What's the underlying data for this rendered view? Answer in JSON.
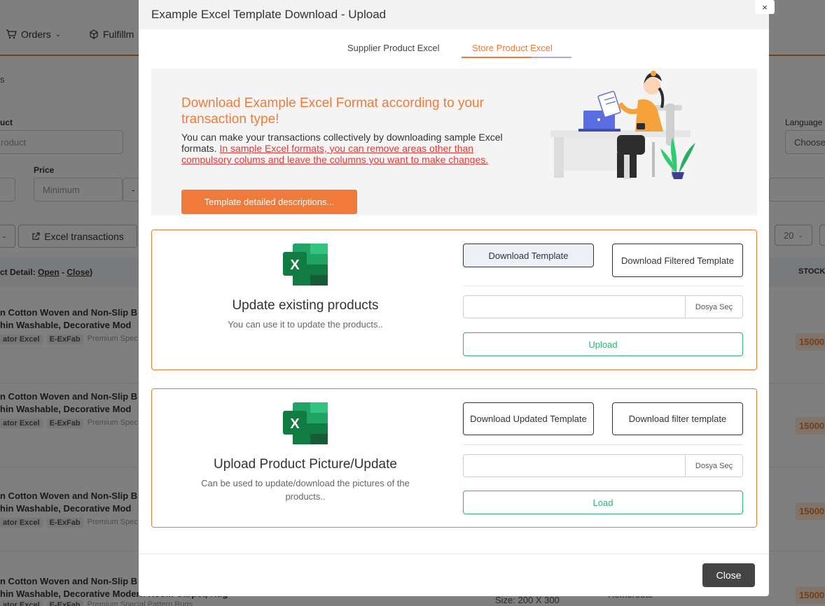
{
  "background": {
    "nav": {
      "orders": "Orders",
      "fulfillment": "Fulfillm"
    },
    "breadcrumb": "s",
    "filters": {
      "product_label": "uct",
      "product_placeholder": "roduct",
      "price_label": "Price",
      "price_min": "Minimum",
      "price_sep": "-",
      "language_label": "Language",
      "language_value": "Choose"
    },
    "excel_button": "Excel transactions",
    "page_size": "20",
    "table": {
      "detail_label": "ct Detail:",
      "open": "Open",
      "dash": "-",
      "close": "Close",
      "close_paren": ")",
      "stock_header": "STOCK"
    },
    "rows": [
      {
        "line1": "n Cotton Woven and Non-Slip B",
        "line2": "hin Washable, Decorative Mod",
        "tag1": "ator Excel",
        "tag2": "E-ExFab",
        "tag3": "Premium Spec",
        "stock": "15000"
      },
      {
        "line1": "n Cotton Woven and Non-Slip B",
        "line2": "hin Washable, Decorative Mod",
        "tag1": "ator Excel",
        "tag2": "E-ExFab",
        "tag3": "Premium Spec",
        "stock": "15000"
      },
      {
        "line1": "n Cotton Woven and Non-Slip B",
        "line2": "hin Washable, Decorative Mod",
        "tag1": "ator Excel",
        "tag2": "E-ExFab",
        "tag3": "Premium Spec",
        "stock": "15000"
      },
      {
        "line1": "n Cotton Woven and Non-Slip B",
        "line2": "hin Washable, Decorative Modern Room Carpet, Rug",
        "tag1": "ator Excel",
        "tag2": "E-ExFab",
        "tag3": "Premium Special Pattern Rugs",
        "stock": "15000",
        "size": "Size: 200 X 300",
        "extra": "Homeroots"
      }
    ]
  },
  "modal": {
    "title": "Example Excel Template Download - Upload",
    "close_x": "×",
    "tabs": [
      {
        "label": "Supplier Product Excel",
        "active": false
      },
      {
        "label": "Store Product Excel",
        "active": true
      }
    ],
    "banner": {
      "heading": "Download Example Excel Format according to your transaction type!",
      "text_plain": "You can make your transactions collectively by downloading sample Excel formats. ",
      "text_highlight": "In sample Excel formats, you can remove areas other than compulsory colums and leave the columns you want to make changes.",
      "button": "Template detailed descriptions..."
    },
    "cards": [
      {
        "icon": "excel-icon",
        "title": "Update existing products",
        "description": "You can use it to update the products..",
        "button1": "Download Template",
        "button2": "Download Filtered Template",
        "file_button": "Dosya Seç",
        "action": "Upload"
      },
      {
        "icon": "excel-icon",
        "title": "Upload Product Picture/Update",
        "description": "Can be used to update/download the pictures of the products..",
        "button1": "Download Updated Template",
        "button2": "Download filter template",
        "file_button": "Dosya Seç",
        "action": "Load"
      }
    ],
    "close_button": "Close"
  },
  "colors": {
    "accent": "#f07a3a",
    "success": "#2bb673",
    "danger": "#e53935",
    "close_button": "#444444"
  }
}
